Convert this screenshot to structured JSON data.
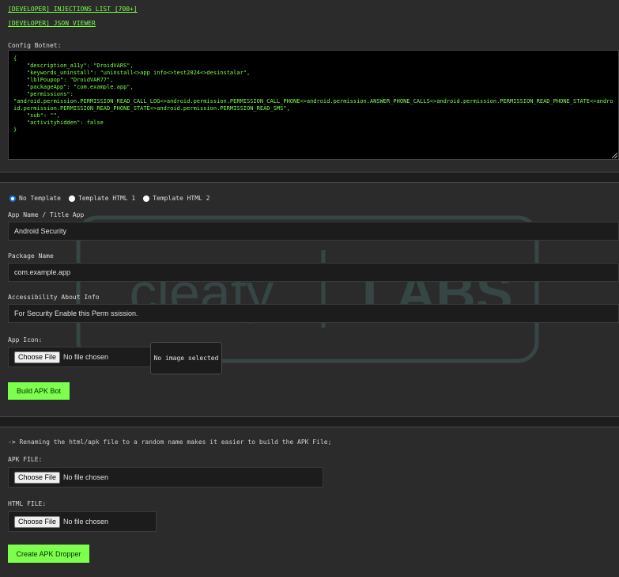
{
  "links": {
    "injections": "[DEVELOPER] INJECTIONS LIST [700+]",
    "json_viewer": "[DEVELOPER] JSON VIEWER"
  },
  "config": {
    "label": "Config Botnet:",
    "content": "{\n    \"description_a11y\": \"DroidVARS\",\n    \"keywords_uninstall\": \"uninstall<>app info<>test2024<>desinstalar\",\n    \"lblPoupop\": \"DroidVAR77\",\n    \"packageApp\": \"com.example.app\",\n    \"permissions\":\n\"android.permission.PERMISSION_READ_CALL_LOG<>android.permission.PERMISSION_CALL_PHONE<>android.permission.ANSWER_PHONE_CALLS<>android.permission.PERMISSION_READ_PHONE_STATE<>android.permission.PERMISSION_READ_PHONE_STATE<>android.permission.PERMISSION_READ_SMS\",\n    \"sub\": \"\",\n    \"activityhidden\": false\n}"
  },
  "templates": {
    "options": [
      "No Template",
      "Template HTML 1",
      "Template HTML 2"
    ],
    "selected": "No Template"
  },
  "form": {
    "app_name_label": "App Name / Title App",
    "app_name_value": "Android Security",
    "package_label": "Package Name",
    "package_value": "com.example.app",
    "a11y_label": "Accessibility About Info",
    "a11y_value": "For Security Enable this Perm ssission.",
    "icon_label": "App Icon:",
    "choose_file": "Choose File",
    "no_file": "No file chosen",
    "preview_text": "No image selected",
    "build_button": "Build APK Bot"
  },
  "dropper": {
    "note": "-> Renaming the html/apk file to a random name makes it easier to build the APK File;",
    "apk_label": "APK FILE:",
    "html_label": "HTML FILE:",
    "choose_file": "Choose File",
    "no_file": "No file chosen",
    "create_button": "Create APK Dropper"
  },
  "watermark": {
    "brand": ".cleafy",
    "labs": "LABS"
  },
  "colors": {
    "accent": "#7cff4d",
    "background": "#2b2b2b",
    "code_bg": "#000000",
    "radio_selected": "#1a73e8"
  }
}
